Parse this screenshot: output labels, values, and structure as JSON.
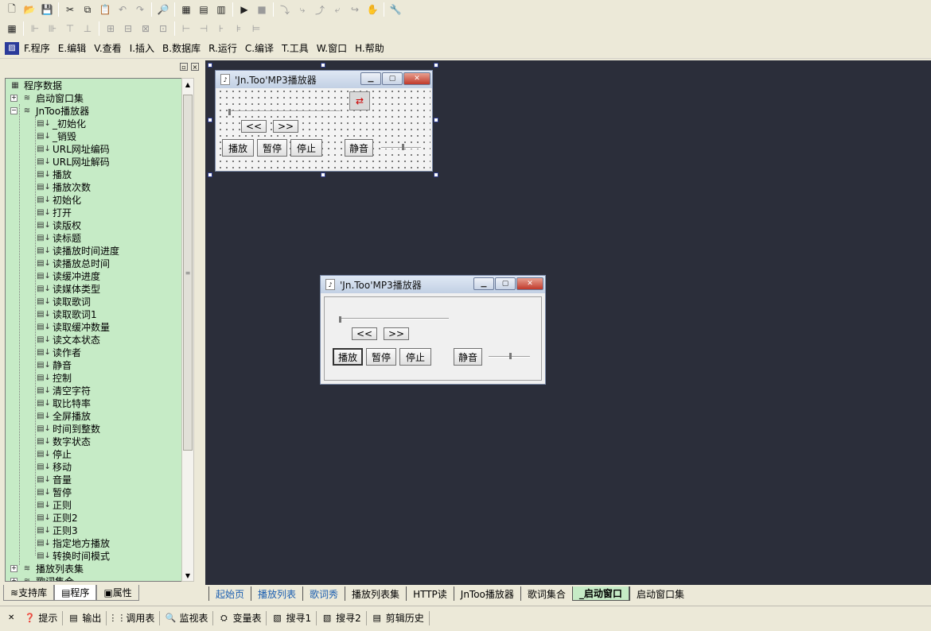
{
  "toolbar1": {
    "icons": [
      "new-file-icon",
      "open-folder-icon",
      "save-icon",
      "cut-icon",
      "copy-icon",
      "paste-icon",
      "undo-icon",
      "redo-icon",
      "find-icon",
      "layout-1-icon",
      "layout-2-icon",
      "layout-3-icon",
      "run-icon",
      "stop-icon",
      "step-1-icon",
      "step-2-icon",
      "step-3-icon",
      "step-4-icon",
      "step-5-icon",
      "hand-icon",
      "debug-icon"
    ],
    "glyphs": [
      "🗋",
      "📂",
      "💾",
      "✂",
      "⧉",
      "📋",
      "↶",
      "↷",
      "🔎",
      "▦",
      "▤",
      "▥",
      "▶",
      "■",
      "⤵",
      "⤷",
      "⤴",
      "⤶",
      "↪",
      "✋",
      "🔧"
    ]
  },
  "toolbar2": {
    "glyphs": [
      "▦",
      "⊩",
      "⊪",
      "⊤",
      "⊥",
      "⊞",
      "⊟",
      "⊠",
      "⊡",
      "⊢",
      "⊣",
      "⊦",
      "⊧",
      "⊨"
    ]
  },
  "menubar": {
    "items": [
      "F.程序",
      "E.编辑",
      "V.查看",
      "I.插入",
      "B.数据库",
      "R.运行",
      "C.编译",
      "T.工具",
      "W.窗口",
      "H.帮助"
    ]
  },
  "tree": {
    "root": "程序数据",
    "nodes": [
      {
        "label": "启动窗口集",
        "level": 1,
        "expander": "+"
      },
      {
        "label": "JnToo播放器",
        "level": 1,
        "expander": "−"
      },
      {
        "label": "_初始化",
        "level": 2
      },
      {
        "label": "_销毁",
        "level": 2
      },
      {
        "label": "URL网址编码",
        "level": 2
      },
      {
        "label": "URL网址解码",
        "level": 2
      },
      {
        "label": "播放",
        "level": 2
      },
      {
        "label": "播放次数",
        "level": 2
      },
      {
        "label": "初始化",
        "level": 2
      },
      {
        "label": "打开",
        "level": 2
      },
      {
        "label": "读版权",
        "level": 2
      },
      {
        "label": "读标题",
        "level": 2
      },
      {
        "label": "读播放时间进度",
        "level": 2
      },
      {
        "label": "读播放总时间",
        "level": 2
      },
      {
        "label": "读缓冲进度",
        "level": 2
      },
      {
        "label": "读媒体类型",
        "level": 2
      },
      {
        "label": "读取歌词",
        "level": 2
      },
      {
        "label": "读取歌词1",
        "level": 2
      },
      {
        "label": "读取缓冲数量",
        "level": 2
      },
      {
        "label": "读文本状态",
        "level": 2
      },
      {
        "label": "读作者",
        "level": 2
      },
      {
        "label": "静音",
        "level": 2
      },
      {
        "label": "控制",
        "level": 2
      },
      {
        "label": "清空字符",
        "level": 2
      },
      {
        "label": "取比特率",
        "level": 2
      },
      {
        "label": "全屏播放",
        "level": 2
      },
      {
        "label": "时间到整数",
        "level": 2
      },
      {
        "label": "数字状态",
        "level": 2
      },
      {
        "label": "停止",
        "level": 2
      },
      {
        "label": "移动",
        "level": 2
      },
      {
        "label": "音量",
        "level": 2
      },
      {
        "label": "暂停",
        "level": 2
      },
      {
        "label": "正则",
        "level": 2
      },
      {
        "label": "正则2",
        "level": 2
      },
      {
        "label": "正则3",
        "level": 2
      },
      {
        "label": "指定地方播放",
        "level": 2
      },
      {
        "label": "转换时间模式",
        "level": 2
      },
      {
        "label": "播放列表集",
        "level": 1,
        "expander": "+"
      },
      {
        "label": "歌词集合",
        "level": 1,
        "expander": "+"
      }
    ]
  },
  "left_tabs": [
    "支持库",
    "程序",
    "属性"
  ],
  "design_window": {
    "title": "'Jn.Too'MP3播放器",
    "buttons": {
      "prev": "<<",
      "next": ">>",
      "play": "播放",
      "pause": "暂停",
      "stop": "停止",
      "mute": "静音"
    }
  },
  "preview_window": {
    "title": "'Jn.Too'MP3播放器",
    "buttons": {
      "prev": "<<",
      "next": ">>",
      "play": "播放",
      "pause": "暂停",
      "stop": "停止",
      "mute": "静音"
    }
  },
  "bottom_tabs": [
    {
      "label": "起始页",
      "style": "link"
    },
    {
      "label": "播放列表",
      "style": "link"
    },
    {
      "label": "歌词秀",
      "style": "link"
    },
    {
      "label": "播放列表集",
      "style": "normal"
    },
    {
      "label": "HTTP读",
      "style": "normal"
    },
    {
      "label": "JnToo播放器",
      "style": "normal"
    },
    {
      "label": "歌词集合",
      "style": "normal"
    },
    {
      "label": "_启动窗口",
      "style": "active"
    },
    {
      "label": "启动窗口集",
      "style": "normal"
    }
  ],
  "statusbar": {
    "items": [
      {
        "icon": "hint-icon",
        "glyph": "❓",
        "label": "提示"
      },
      {
        "icon": "output-icon",
        "glyph": "▤",
        "label": "输出"
      },
      {
        "icon": "call-table-icon",
        "glyph": "⋮⋮",
        "label": "调用表"
      },
      {
        "icon": "watch-icon",
        "glyph": "🔍",
        "label": "监视表"
      },
      {
        "icon": "variable-icon",
        "glyph": "⛭",
        "label": "变量表"
      },
      {
        "icon": "search1-icon",
        "glyph": "▧",
        "label": "搜寻1"
      },
      {
        "icon": "search2-icon",
        "glyph": "▧",
        "label": "搜寻2"
      },
      {
        "icon": "clipboard-history-icon",
        "glyph": "▤",
        "label": "剪辑历史"
      }
    ]
  },
  "colors": {
    "tree_bg": "#c6ebc6",
    "workspace_bg": "#2b2e3a",
    "chrome_bg": "#ece9d8",
    "link_tab": "#1a5eb0"
  }
}
